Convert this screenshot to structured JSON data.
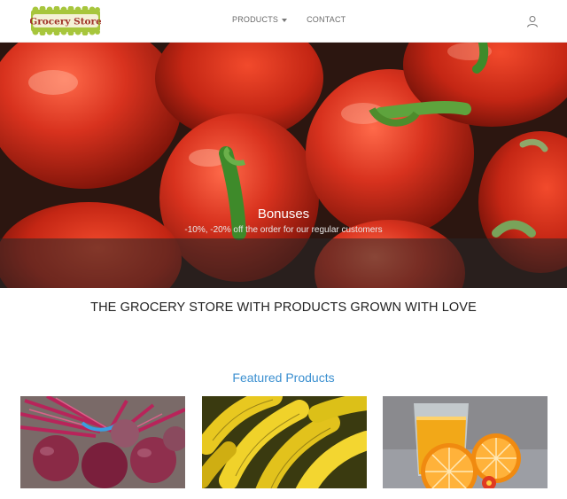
{
  "logo": {
    "text": "Grocery Store"
  },
  "nav": {
    "products_label": "PRODUCTS",
    "contact_label": "CONTACT"
  },
  "hero": {
    "title": "Bonuses",
    "subtitle": "-10%, -20% off the order for our regular customers"
  },
  "tagline": "THE GROCERY STORE WITH PRODUCTS GROWN WITH LOVE",
  "featured": {
    "title": "Featured Products",
    "products": [
      {
        "image": "beets"
      },
      {
        "image": "bananas"
      },
      {
        "image": "orange-juice"
      }
    ]
  },
  "colors": {
    "accent_blue": "#3a8fd0",
    "logo_green": "#9ec33a",
    "hero_red": "#d8321e"
  }
}
